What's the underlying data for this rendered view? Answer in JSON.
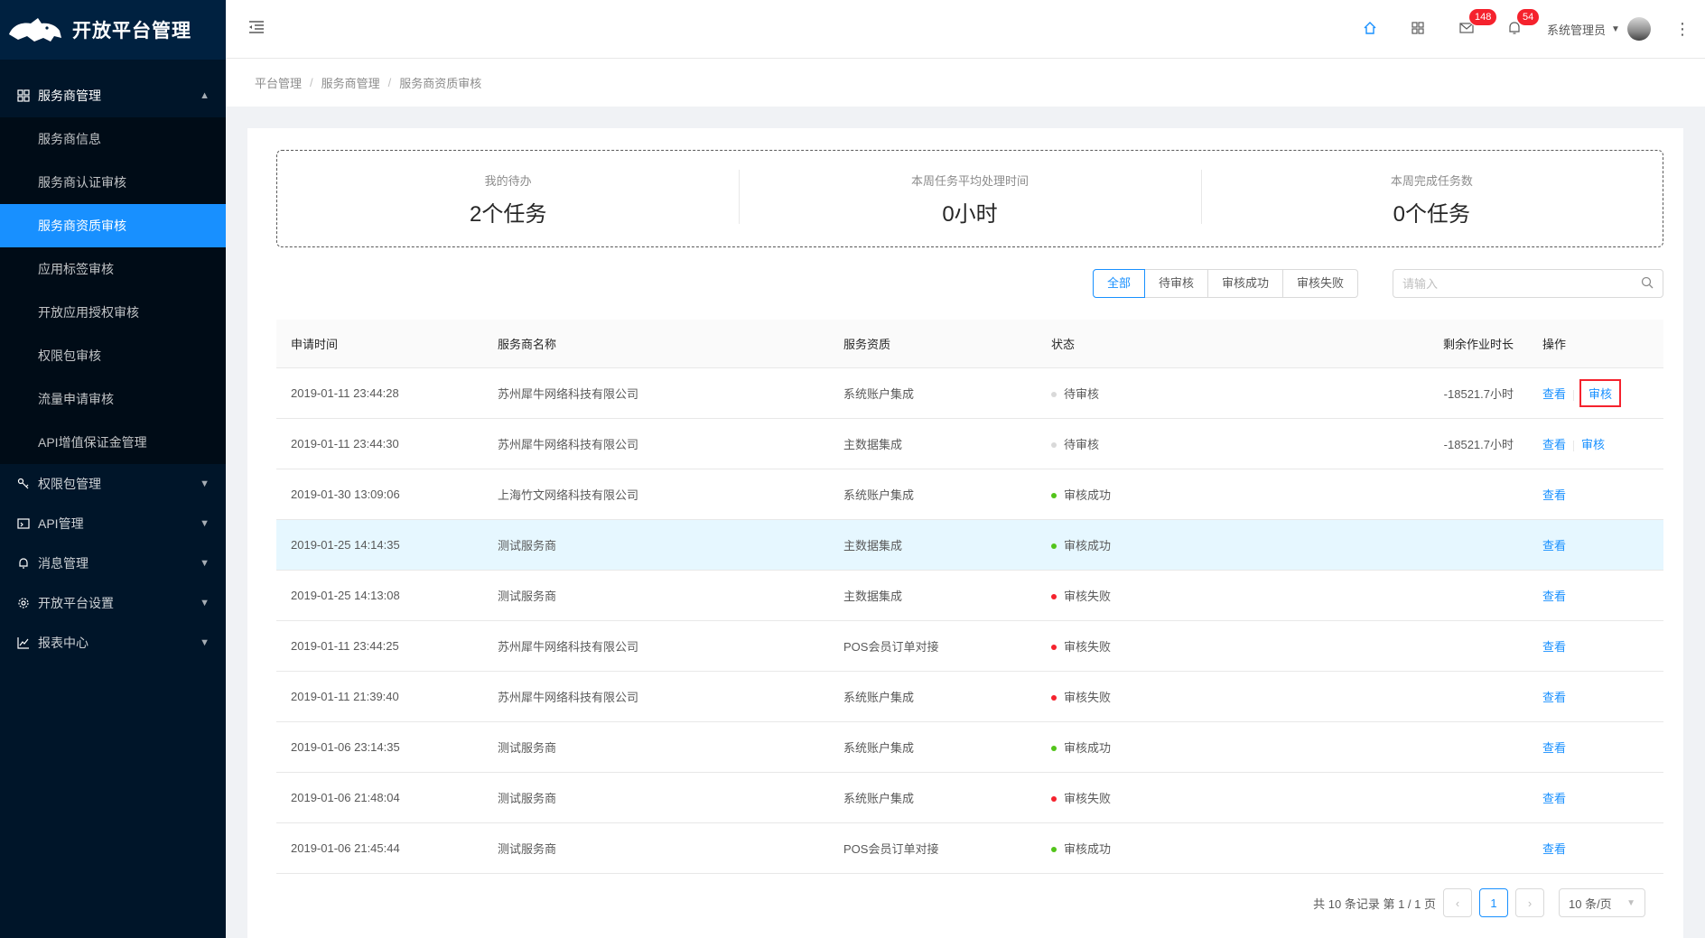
{
  "app": {
    "title": "开放平台管理"
  },
  "sidebar": {
    "groups": [
      {
        "label": "服务商管理",
        "icon": "team-icon",
        "open": true,
        "items": [
          {
            "label": "服务商信息"
          },
          {
            "label": "服务商认证审核"
          },
          {
            "label": "服务商资质审核",
            "active": true
          },
          {
            "label": "应用标签审核"
          },
          {
            "label": "开放应用授权审核"
          },
          {
            "label": "权限包审核"
          },
          {
            "label": "流量申请审核"
          },
          {
            "label": "API增值保证金管理"
          }
        ]
      },
      {
        "label": "权限包管理",
        "icon": "key-icon"
      },
      {
        "label": "API管理",
        "icon": "api-icon"
      },
      {
        "label": "消息管理",
        "icon": "bell-icon"
      },
      {
        "label": "开放平台设置",
        "icon": "setting-icon"
      },
      {
        "label": "报表中心",
        "icon": "line-chart-icon"
      }
    ]
  },
  "header": {
    "mail_badge": "148",
    "bell_badge": "54",
    "user_name": "系统管理员"
  },
  "breadcrumb": [
    "平台管理",
    "服务商管理",
    "服务商资质审核"
  ],
  "stats": [
    {
      "label": "我的待办",
      "value": "2个任务"
    },
    {
      "label": "本周任务平均处理时间",
      "value": "0小时"
    },
    {
      "label": "本周完成任务数",
      "value": "0个任务"
    }
  ],
  "filters": {
    "options": [
      "全部",
      "待审核",
      "审核成功",
      "审核失败"
    ],
    "selected": "全部"
  },
  "search": {
    "placeholder": "请输入"
  },
  "table": {
    "columns": [
      "申请时间",
      "服务商名称",
      "服务资质",
      "状态",
      "剩余作业时长",
      "操作"
    ],
    "rows": [
      {
        "time": "2019-01-11 23:44:28",
        "name": "苏州犀牛网络科技有限公司",
        "qual": "系统账户集成",
        "status": "待审核",
        "status_type": "pending",
        "remaining": "-18521.7小时",
        "actions": [
          "查看",
          "审核"
        ],
        "review_highlighted": true
      },
      {
        "time": "2019-01-11 23:44:30",
        "name": "苏州犀牛网络科技有限公司",
        "qual": "主数据集成",
        "status": "待审核",
        "status_type": "pending",
        "remaining": "-18521.7小时",
        "actions": [
          "查看",
          "审核"
        ]
      },
      {
        "time": "2019-01-30 13:09:06",
        "name": "上海竹文网络科技有限公司",
        "qual": "系统账户集成",
        "status": "审核成功",
        "status_type": "success",
        "remaining": "",
        "actions": [
          "查看"
        ]
      },
      {
        "time": "2019-01-25 14:14:35",
        "name": "测试服务商",
        "qual": "主数据集成",
        "status": "审核成功",
        "status_type": "success",
        "remaining": "",
        "actions": [
          "查看"
        ],
        "hovered": true
      },
      {
        "time": "2019-01-25 14:13:08",
        "name": "测试服务商",
        "qual": "主数据集成",
        "status": "审核失败",
        "status_type": "fail",
        "remaining": "",
        "actions": [
          "查看"
        ]
      },
      {
        "time": "2019-01-11 23:44:25",
        "name": "苏州犀牛网络科技有限公司",
        "qual": "POS会员订单对接",
        "status": "审核失败",
        "status_type": "fail",
        "remaining": "",
        "actions": [
          "查看"
        ]
      },
      {
        "time": "2019-01-11 21:39:40",
        "name": "苏州犀牛网络科技有限公司",
        "qual": "系统账户集成",
        "status": "审核失败",
        "status_type": "fail",
        "remaining": "",
        "actions": [
          "查看"
        ]
      },
      {
        "time": "2019-01-06 23:14:35",
        "name": "测试服务商",
        "qual": "系统账户集成",
        "status": "审核成功",
        "status_type": "success",
        "remaining": "",
        "actions": [
          "查看"
        ]
      },
      {
        "time": "2019-01-06 21:48:04",
        "name": "测试服务商",
        "qual": "系统账户集成",
        "status": "审核失败",
        "status_type": "fail",
        "remaining": "",
        "actions": [
          "查看"
        ]
      },
      {
        "time": "2019-01-06 21:45:44",
        "name": "测试服务商",
        "qual": "POS会员订单对接",
        "status": "审核成功",
        "status_type": "success",
        "remaining": "",
        "actions": [
          "查看"
        ]
      }
    ]
  },
  "pagination": {
    "summary": "共 10 条记录 第 1 / 1 页",
    "current_page": "1",
    "page_size": "10 条/页"
  },
  "colors": {
    "primary": "#1890ff",
    "sidebar_bg": "#001529",
    "success": "#52c41a",
    "error": "#f5222d",
    "pending": "#d9d9d9"
  }
}
